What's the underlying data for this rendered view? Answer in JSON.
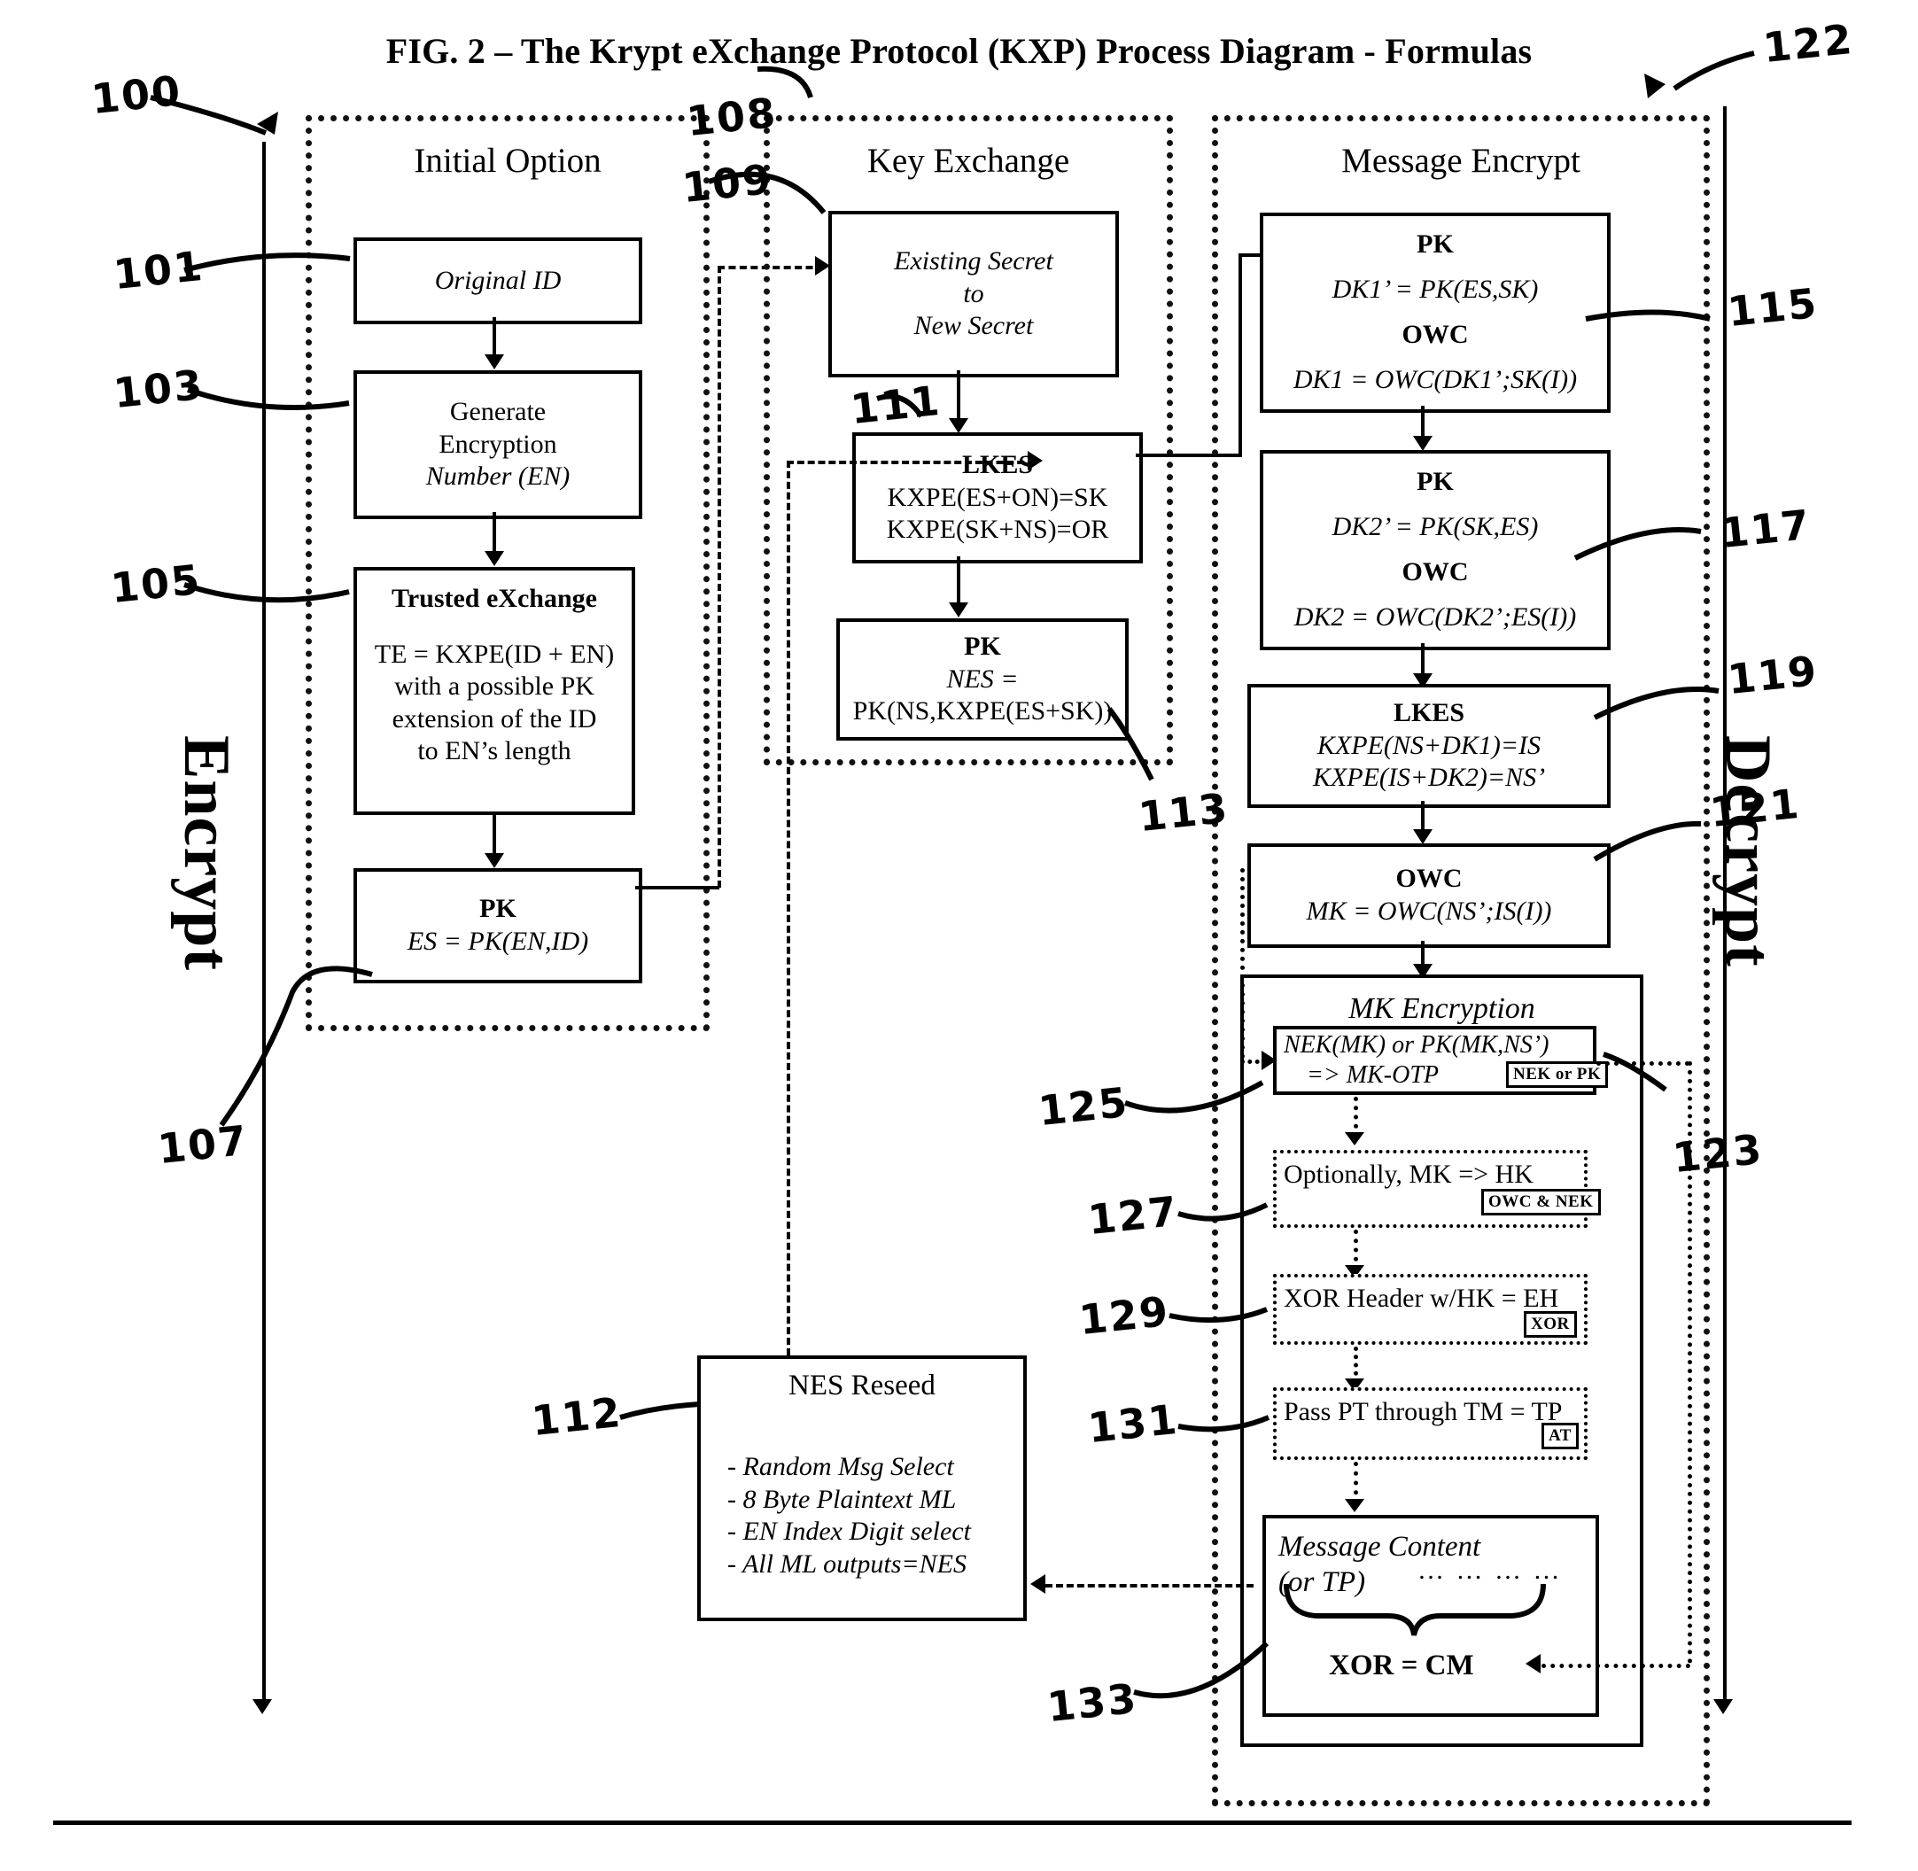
{
  "figure": {
    "title": "FIG. 2 – The Krypt eXchange Protocol (KXP) Process Diagram - Formulas"
  },
  "side_labels": {
    "left": "Encrypt",
    "right": "Decrypt"
  },
  "groups": {
    "initial_option": {
      "title": "Initial Option"
    },
    "key_exchange": {
      "title": "Key Exchange"
    },
    "message_encrypt": {
      "title": "Message Encrypt"
    }
  },
  "boxes": {
    "original_id": {
      "text": "Original ID"
    },
    "generate_en": {
      "l1": "Generate",
      "l2": "Encryption",
      "l3": "Number (EN)"
    },
    "trusted_exchange": {
      "title": "Trusted eXchange",
      "l1": "TE = KXPE(ID + EN)",
      "l2": "with a possible PK",
      "l3": "extension of the ID",
      "l4": "to EN’s length"
    },
    "pk_es": {
      "title": "PK",
      "l1": "ES = PK(EN,ID)"
    },
    "existing_to_new": {
      "l1": "Existing Secret",
      "l2": "to",
      "l3": "New Secret"
    },
    "lkes_kx": {
      "title": "LKES",
      "l1": "KXPE(ES+ON)=SK",
      "l2": "KXPE(SK+NS)=OR"
    },
    "pk_nes": {
      "title": "PK",
      "l1": "NES =",
      "l2": "PK(NS,KXPE(ES+SK))"
    },
    "pk_owc_1": {
      "t1": "PK",
      "f1": "DK1’ = PK(ES,SK)",
      "t2": "OWC",
      "f2": "DK1 = OWC(DK1’;SK(I))"
    },
    "pk_owc_2": {
      "t1": "PK",
      "f1": "DK2’ = PK(SK,ES)",
      "t2": "OWC",
      "f2": "DK2 = OWC(DK2’;ES(I))"
    },
    "lkes_me": {
      "title": "LKES",
      "l1": "KXPE(NS+DK1)=IS",
      "l2": "KXPE(IS+DK2)=NS’"
    },
    "owc_mk": {
      "title": "OWC",
      "l1": "MK = OWC(NS’;IS(I))"
    },
    "mk_encryption": {
      "title": "MK Encryption"
    },
    "mk_otp": {
      "l1": "NEK(MK) or PK(MK,NS’)",
      "l2": "=> MK-OTP",
      "chip": "NEK or PK"
    },
    "mk_hk": {
      "l1": "Optionally,",
      "l2": "MK => HK",
      "chip": "OWC & NEK"
    },
    "xor_header": {
      "l1": "XOR Header w/HK = EH",
      "chip": "XOR"
    },
    "pass_pt": {
      "l1": "Pass PT through TM = TP",
      "chip": "AT"
    },
    "message_content": {
      "l1": "Message Content",
      "l2": "(or TP)",
      "dots": "… … … …",
      "l3": "XOR = CM"
    },
    "nes_reseed": {
      "title": "NES Reseed",
      "b1": "- Random Msg Select",
      "b2": "- 8 Byte Plaintext ML",
      "b3": "- EN Index Digit select",
      "b4": "- All ML outputs=NES"
    }
  },
  "reference_numerals": {
    "n100": "100",
    "n101": "101",
    "n103": "103",
    "n105": "105",
    "n107": "107",
    "n108": "108",
    "n109": "109",
    "n111": "111",
    "n112": "112",
    "n113": "113",
    "n115": "115",
    "n117": "117",
    "n119": "119",
    "n121": "121",
    "n122": "122",
    "n123": "123",
    "n125": "125",
    "n127": "127",
    "n129": "129",
    "n131": "131",
    "n133": "133"
  }
}
